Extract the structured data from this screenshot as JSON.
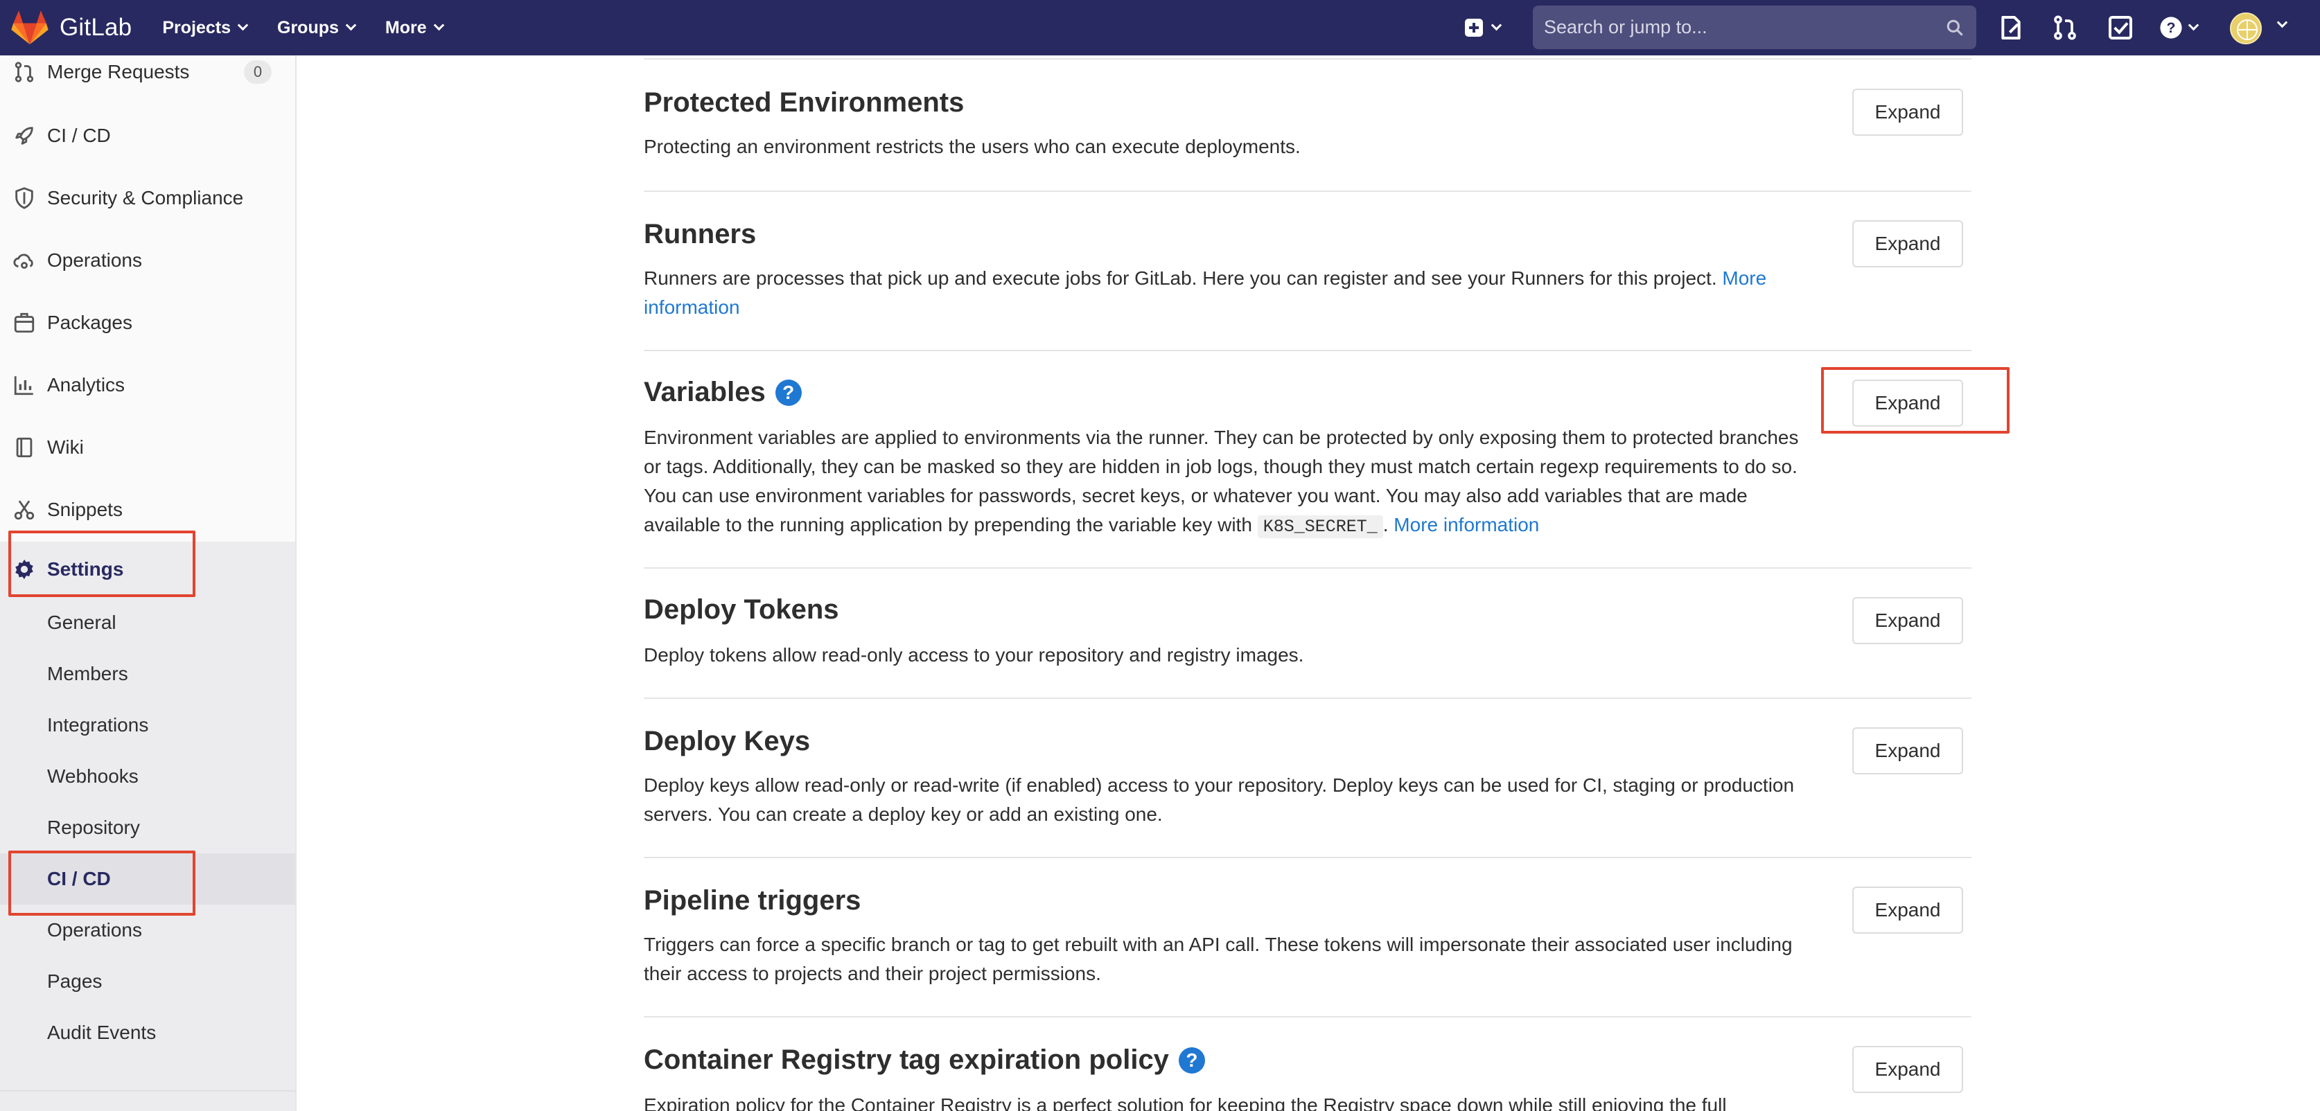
{
  "header": {
    "brand": "GitLab",
    "nav": [
      {
        "label": "Projects"
      },
      {
        "label": "Groups"
      },
      {
        "label": "More"
      }
    ],
    "search_placeholder": "Search or jump to...",
    "colors": {
      "bar": "#292961",
      "brand_orange": "#e24329"
    }
  },
  "sidebar": {
    "items": [
      {
        "label": "Merge Requests",
        "icon": "merge-request-icon",
        "count": "0"
      },
      {
        "label": "CI / CD",
        "icon": "rocket-icon"
      },
      {
        "label": "Security & Compliance",
        "icon": "shield-icon"
      },
      {
        "label": "Operations",
        "icon": "cloud-gear-icon"
      },
      {
        "label": "Packages",
        "icon": "package-icon"
      },
      {
        "label": "Analytics",
        "icon": "chart-icon"
      },
      {
        "label": "Wiki",
        "icon": "book-icon"
      },
      {
        "label": "Snippets",
        "icon": "scissors-icon"
      },
      {
        "label": "Settings",
        "icon": "gear-icon",
        "active": true
      }
    ],
    "settings_sub": [
      {
        "label": "General"
      },
      {
        "label": "Members"
      },
      {
        "label": "Integrations"
      },
      {
        "label": "Webhooks"
      },
      {
        "label": "Repository"
      },
      {
        "label": "CI / CD",
        "active": true
      },
      {
        "label": "Operations"
      },
      {
        "label": "Pages"
      },
      {
        "label": "Audit Events"
      }
    ]
  },
  "main": {
    "expand_label": "Expand",
    "sections": [
      {
        "title": "Protected Environments",
        "description": "Protecting an environment restricts the users who can execute deployments."
      },
      {
        "title": "Runners",
        "description": "Runners are processes that pick up and execute jobs for GitLab. Here you can register and see your Runners for this project.",
        "link": "More information"
      },
      {
        "title": "Variables",
        "description_before_code": "Environment variables are applied to environments via the runner. They can be protected by only exposing them to protected branches or tags. Additionally, they can be masked so they are hidden in job logs, though they must match certain regexp requirements to do so. You can use environment variables for passwords, secret keys, or whatever you want. You may also add variables that are made available to the running application by prepending the variable key with",
        "code": "K8S_SECRET_",
        "after_code": ".",
        "link": "More information"
      },
      {
        "title": "Deploy Tokens",
        "description": "Deploy tokens allow read-only access to your repository and registry images."
      },
      {
        "title": "Deploy Keys",
        "description": "Deploy keys allow read-only or read-write (if enabled) access to your repository. Deploy keys can be used for CI, staging or production servers. You can create a deploy key or add an existing one."
      },
      {
        "title": "Pipeline triggers",
        "description": "Triggers can force a specific branch or tag to get rebuilt with an API call. These tokens will impersonate their associated user including their access to projects and their project permissions."
      },
      {
        "title": "Container Registry tag expiration policy",
        "description": "Expiration policy for the Container Registry is a perfect solution for keeping the Registry space down while still enjoying the full"
      }
    ],
    "colors": {
      "link": "#1f78d1",
      "highlight": "#e2442f"
    }
  }
}
